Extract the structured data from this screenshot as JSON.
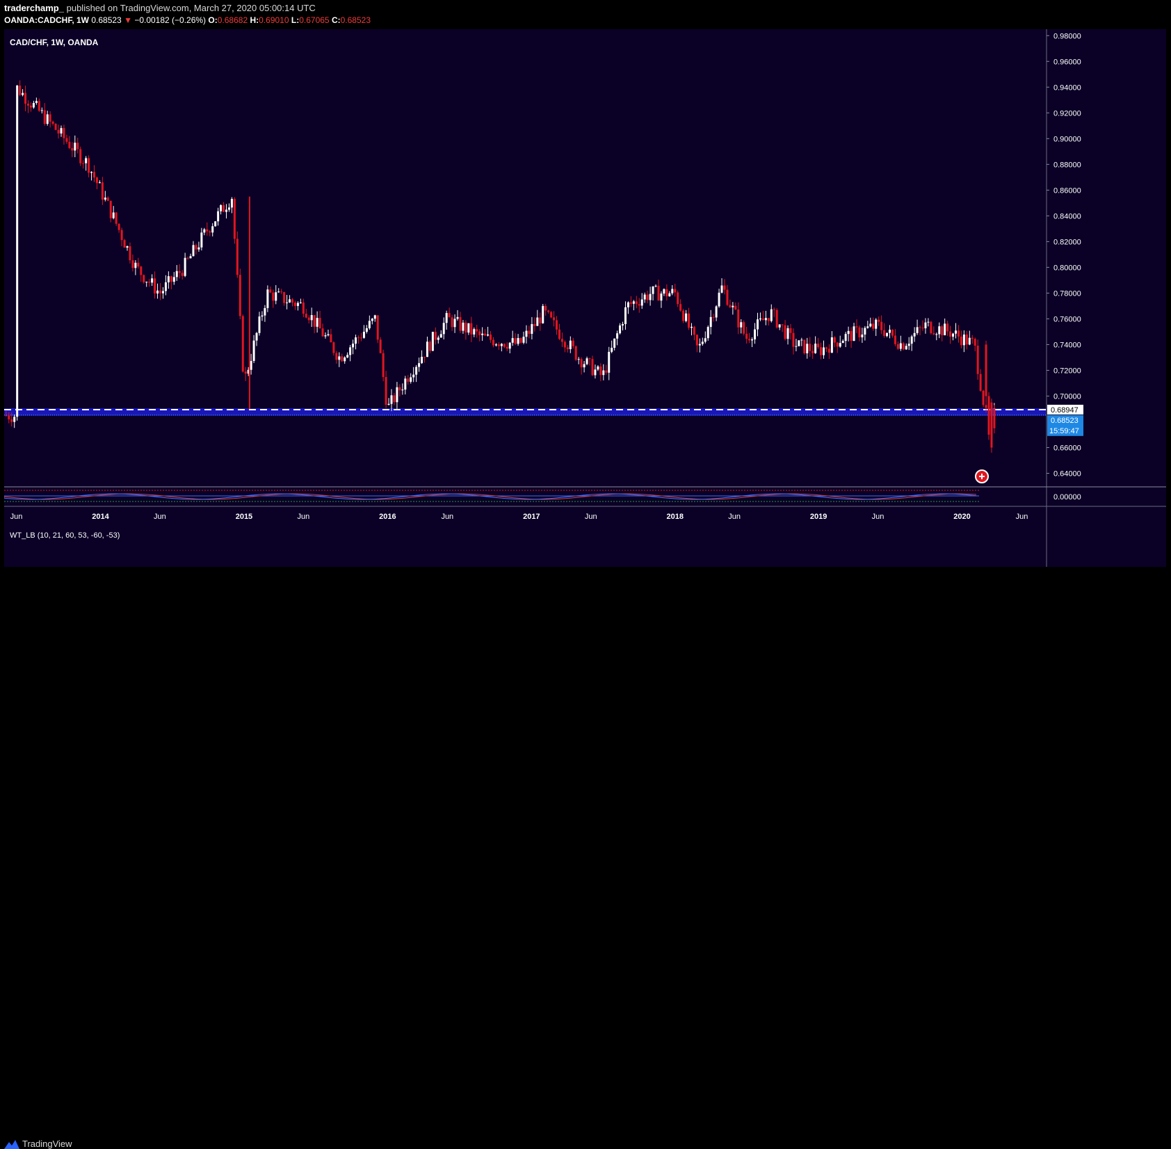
{
  "header": {
    "author": "traderchamp_",
    "published": "published on TradingView.com, March 27, 2020 05:00:14 UTC",
    "symbol": "OANDA:CADCHF, 1W",
    "last": "0.68523",
    "change_arrow": "▼",
    "change": "−0.00182 (−0.26%)",
    "o_label": "O:",
    "o_value": "0.68682",
    "h_label": "H:",
    "h_value": "0.69010",
    "l_label": "L:",
    "l_value": "0.67065",
    "c_label": "C:",
    "c_value": "0.68523"
  },
  "chart_title": "CAD/CHF, 1W, OANDA",
  "indicator_label": "WT_LB (10, 21, 60, 53, -60, -53)",
  "brand": "TradingView",
  "colors": {
    "background": "#0b0126",
    "up": "#ffffff",
    "down": "#e0161f",
    "support_zone": "#1a17b8",
    "price_tag": "#1e88e5",
    "axis_text": "#ffffff"
  },
  "price_axis": {
    "labels": [
      "0.98000",
      "0.96000",
      "0.94000",
      "0.92000",
      "0.90000",
      "0.88000",
      "0.86000",
      "0.84000",
      "0.82000",
      "0.80000",
      "0.78000",
      "0.76000",
      "0.74000",
      "0.72000",
      "0.70000",
      "0.66000",
      "0.64000"
    ],
    "ylim": [
      0.63,
      0.985
    ],
    "dashed_level": "0.68947",
    "current_price": "0.68523",
    "countdown": "15:59:47"
  },
  "indicator_axis": {
    "label": "0.00000"
  },
  "time_axis": {
    "labels": [
      "Jun",
      "2014",
      "Jun",
      "2015",
      "Jun",
      "2016",
      "Jun",
      "2017",
      "Jun",
      "2018",
      "Jun",
      "2019",
      "Jun",
      "2020",
      "Jun"
    ],
    "range": [
      "2013-05",
      "2020-08"
    ]
  },
  "chart_data": {
    "type": "candlestick",
    "title": "CAD/CHF, 1W, OANDA",
    "ylim": [
      0.63,
      0.985
    ],
    "support_zone": [
      0.6847,
      0.6905
    ],
    "dashed_level": 0.68947,
    "last_close": 0.68523,
    "series": [
      {
        "name": "CAD/CHF weekly close (approx.)",
        "x": [
          "2013-06",
          "2013-09",
          "2013-12",
          "2014-02",
          "2014-04",
          "2014-06",
          "2014-08",
          "2014-10",
          "2014-12",
          "2015-01",
          "2015-03",
          "2015-06",
          "2015-09",
          "2015-12",
          "2016-01",
          "2016-03",
          "2016-06",
          "2016-09",
          "2016-12",
          "2017-02",
          "2017-05",
          "2017-07",
          "2017-09",
          "2017-11",
          "2018-01",
          "2018-03",
          "2018-05",
          "2018-07",
          "2018-09",
          "2018-11",
          "2019-01",
          "2019-03",
          "2019-06",
          "2019-08",
          "2019-10",
          "2019-12",
          "2020-02",
          "2020-03"
        ],
        "values": [
          0.94,
          0.91,
          0.88,
          0.84,
          0.8,
          0.78,
          0.8,
          0.83,
          0.855,
          0.71,
          0.78,
          0.77,
          0.73,
          0.76,
          0.69,
          0.72,
          0.76,
          0.745,
          0.74,
          0.765,
          0.73,
          0.715,
          0.77,
          0.78,
          0.78,
          0.735,
          0.785,
          0.745,
          0.765,
          0.74,
          0.735,
          0.745,
          0.755,
          0.74,
          0.755,
          0.75,
          0.74,
          0.685
        ]
      }
    ]
  }
}
